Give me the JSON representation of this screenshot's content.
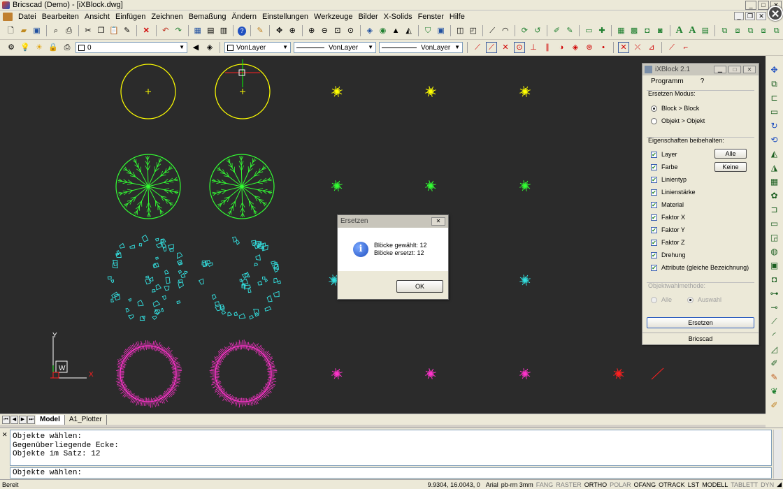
{
  "window": {
    "title": "Bricscad (Demo) - [iXBlock.dwg]",
    "buttons": [
      "_",
      "□",
      "✕"
    ]
  },
  "menu": [
    "Datei",
    "Bearbeiten",
    "Ansicht",
    "Einfügen",
    "Zeichnen",
    "Bemaßung",
    "Ändern",
    "Einstellungen",
    "Werkzeuge",
    "Bilder",
    "X-Solids",
    "Fenster",
    "Hilfe"
  ],
  "layerbar": {
    "layer": "0",
    "color": "VonLayer",
    "linetype": "VonLayer",
    "lineweight": "VonLayer"
  },
  "tabs": [
    "Model",
    "A1_Plotter"
  ],
  "active_tab": "Model",
  "commands": {
    "history": [
      "Objekte wählen:",
      "Gegenüberliegende Ecke:",
      "Objekte im Satz: 12"
    ],
    "prompt": "Objekte wählen:"
  },
  "status": {
    "left": "Bereit",
    "coords": "9.9304, 16.0043, 0",
    "font": "Arial",
    "style": "pb-rm 3mm",
    "toggles": [
      {
        "label": "FANG",
        "on": false
      },
      {
        "label": "RASTER",
        "on": false
      },
      {
        "label": "ORTHO",
        "on": true
      },
      {
        "label": "POLAR",
        "on": false
      },
      {
        "label": "OFANG",
        "on": true
      },
      {
        "label": "OTRACK",
        "on": true
      },
      {
        "label": "LST",
        "on": true
      },
      {
        "label": "MODELL",
        "on": true
      },
      {
        "label": "TABLETT",
        "on": false
      },
      {
        "label": "DYN",
        "on": false
      }
    ]
  },
  "ucs": {
    "x": "X",
    "y": "Y",
    "w": "W"
  },
  "panel": {
    "title": "iXBlock 2.1",
    "menu": [
      "Programm",
      "?"
    ],
    "mode_title": "Ersetzen Modus:",
    "modes": [
      {
        "label": "Block > Block",
        "selected": true
      },
      {
        "label": "Objekt > Objekt",
        "selected": false
      }
    ],
    "props_title": "Eigenschaften beibehalten:",
    "props": [
      {
        "label": "Layer",
        "checked": true
      },
      {
        "label": "Farbe",
        "checked": true
      },
      {
        "label": "Linientyp",
        "checked": true
      },
      {
        "label": "Linienstärke",
        "checked": true
      },
      {
        "label": "Material",
        "checked": true
      },
      {
        "label": "Faktor X",
        "checked": true
      },
      {
        "label": "Faktor Y",
        "checked": true
      },
      {
        "label": "Faktor Z",
        "checked": true
      },
      {
        "label": "Drehung",
        "checked": true
      },
      {
        "label": "Attribute (gleiche Bezeichnung)",
        "checked": true
      }
    ],
    "all_label": "Alle",
    "none_label": "Keine",
    "select_title": "Objektwahlmethode:",
    "select_opts": [
      {
        "label": "Alle",
        "selected": false
      },
      {
        "label": "Auswahl",
        "selected": true
      }
    ],
    "replace_label": "Ersetzen",
    "footer": "Bricscad"
  },
  "dialog": {
    "title": "Ersetzen",
    "line1": "Blöcke gewählt: 12",
    "line2": "Blöcke ersetzt: 12",
    "ok": "OK"
  },
  "colors": {
    "yellow": "#ffff00",
    "green": "#33ff33",
    "cyan": "#33e0e0",
    "magenta": "#ff33cc",
    "red": "#ff2020",
    "canvas": "#2b2b2b"
  }
}
